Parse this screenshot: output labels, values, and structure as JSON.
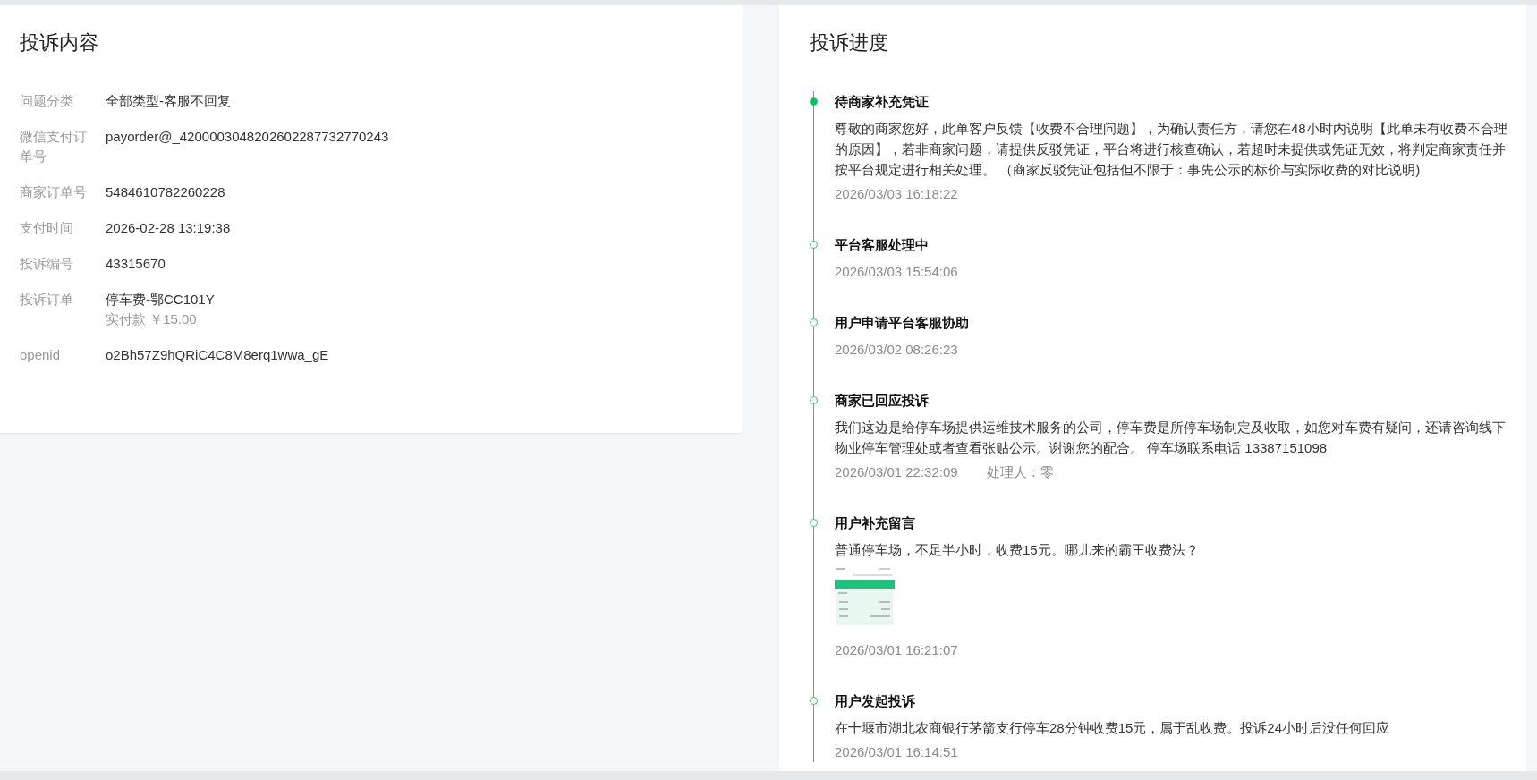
{
  "complaint_content": {
    "title": "投诉内容",
    "fields": [
      {
        "label": "问题分类",
        "value": "全部类型-客服不回复"
      },
      {
        "label": "微信支付订单号",
        "value": "payorder@_4200003048202602287732770243"
      },
      {
        "label": "商家订单号",
        "value": "5484610782260228"
      },
      {
        "label": "支付时间",
        "value": "2026-02-28 13:19:38"
      },
      {
        "label": "投诉编号",
        "value": "43315670"
      },
      {
        "label": "投诉订单",
        "value": "停车费-鄂CC101Y",
        "note": "实付款 ￥15.00"
      },
      {
        "label": "openid",
        "value": "o2Bh57Z9hQRiC4C8M8erq1wwa_gE"
      }
    ]
  },
  "progress": {
    "title": "投诉进度",
    "steps": [
      {
        "title": "待商家补充凭证",
        "current": true,
        "body": "尊敬的商家您好，此单客户反馈【收费不合理问题】，为确认责任方，请您在48小时内说明【此单未有收费不合理的原因】，若非商家问题，请提供反驳凭证，平台将进行核查确认，若超时未提供或凭证无效，将判定商家责任并按平台规定进行相关处理。  （商家反驳凭证包括但不限于：事先公示的标价与实际收费的对比说明)",
        "time": "2026/03/03 16:18:22"
      },
      {
        "title": "平台客服处理中",
        "current": false,
        "time": "2026/03/03 15:54:06"
      },
      {
        "title": "用户申请平台客服协助",
        "current": false,
        "time": "2026/03/02 08:26:23"
      },
      {
        "title": "商家已回应投诉",
        "current": false,
        "body": "我们这边是给停车场提供运维技术服务的公司，停车费是所停车场制定及收取，如您对车费有疑问，还请咨询线下物业停车管理处或者查看张贴公示。谢谢您的配合。 停车场联系电话 13387151098",
        "time": "2026/03/01 22:32:09",
        "handler": "处理人：零"
      },
      {
        "title": "用户补充留言",
        "current": false,
        "body": "普通停车场，不足半小时，收费15元。哪儿来的霸王收费法？",
        "time": "2026/03/01 16:21:07"
      },
      {
        "title": "用户发起投诉",
        "current": false,
        "body": "在十堰市湖北农商银行茅箭支行停车28分钟收费15元，属于乱收费。投诉24小时后没任何回应",
        "time": "2026/03/01 16:14:51"
      }
    ]
  }
}
